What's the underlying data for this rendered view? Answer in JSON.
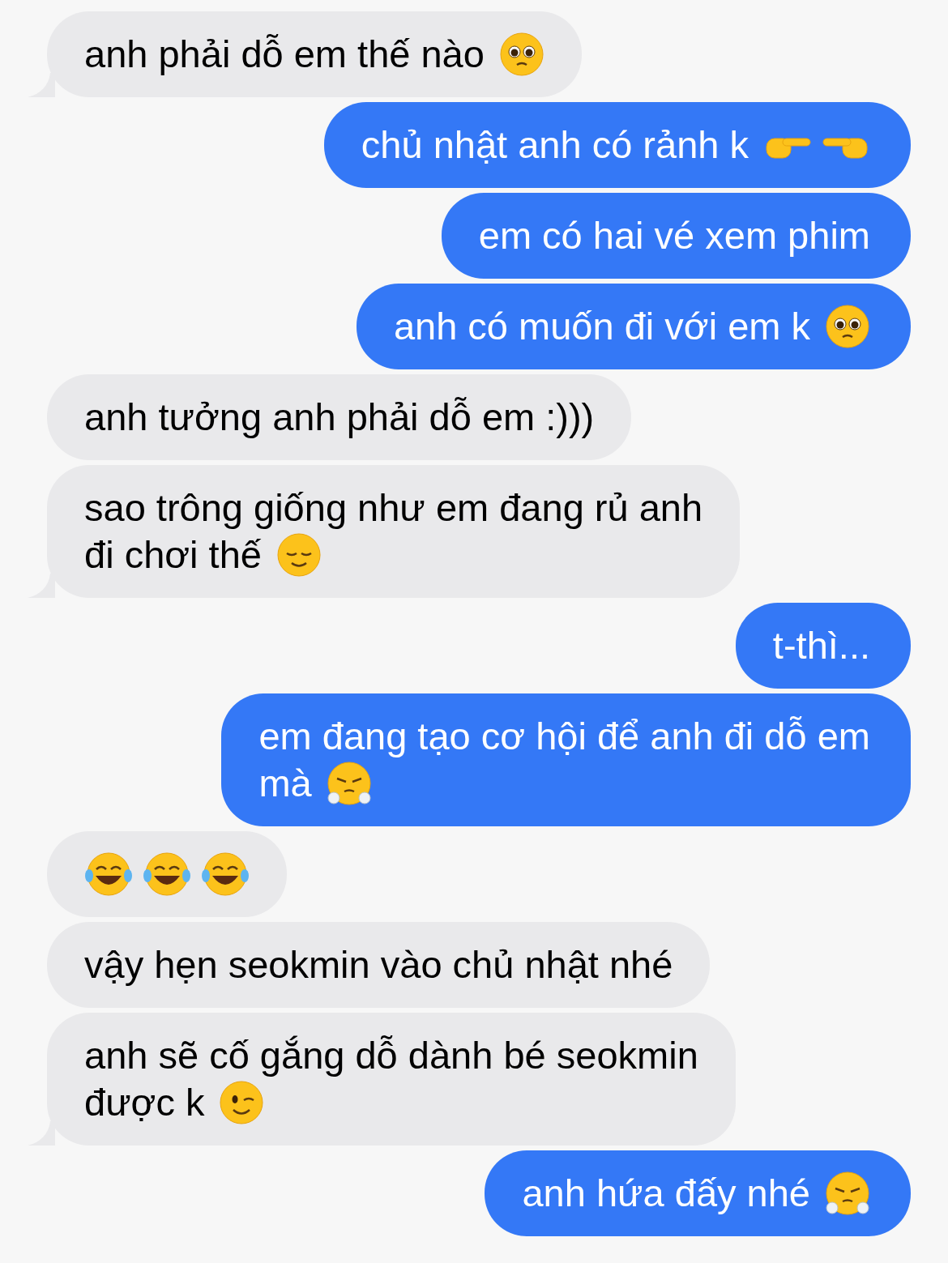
{
  "messages": [
    {
      "kind": "received",
      "tail": true,
      "lines": [
        "anh phải dỗ em thế nào"
      ],
      "emojis": [
        {
          "kind": "pleading"
        }
      ]
    },
    {
      "kind": "sent",
      "tail": false,
      "lines": [
        "chủ nhật anh có rảnh k"
      ],
      "emojis": [
        {
          "kind": "point-right"
        },
        {
          "kind": "point-left"
        }
      ]
    },
    {
      "kind": "sent",
      "tail": false,
      "lines": [
        "em có hai vé xem phim"
      ]
    },
    {
      "kind": "sent",
      "tail": false,
      "lines": [
        "anh có muốn đi với em k"
      ],
      "emojis": [
        {
          "kind": "pleading"
        }
      ]
    },
    {
      "kind": "received",
      "tail": false,
      "lines": [
        "anh tưởng anh phải dỗ em :)))"
      ]
    },
    {
      "kind": "received",
      "tail": true,
      "lines": [
        "sao trông giống như em đang rủ anh",
        "đi chơi thế"
      ],
      "emojis": [
        {
          "kind": "relieved"
        }
      ]
    },
    {
      "kind": "sent",
      "tail": false,
      "lines": [
        "t-thì..."
      ]
    },
    {
      "kind": "sent",
      "tail": false,
      "lines": [
        "em đang tạo cơ hội để anh đi dỗ em",
        "mà"
      ],
      "emojis": [
        {
          "kind": "steam"
        }
      ]
    },
    {
      "kind": "received",
      "tail": false,
      "emojis": [
        {
          "kind": "joy"
        },
        {
          "kind": "joy"
        },
        {
          "kind": "joy"
        }
      ]
    },
    {
      "kind": "received",
      "tail": false,
      "lines": [
        "vậy hẹn seokmin vào chủ nhật nhé"
      ]
    },
    {
      "kind": "received",
      "tail": true,
      "lines": [
        "anh sẽ cố gắng dỗ dành bé seokmin",
        "được k"
      ],
      "emojis": [
        {
          "kind": "wink"
        }
      ]
    },
    {
      "kind": "sent",
      "tail": false,
      "lines": [
        "anh hứa đấy nhé"
      ],
      "emojis": [
        {
          "kind": "steam"
        }
      ]
    }
  ]
}
